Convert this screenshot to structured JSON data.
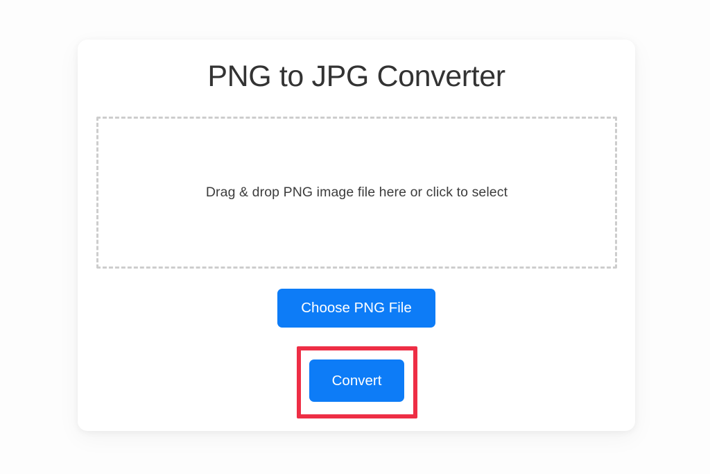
{
  "page": {
    "background_color": "#fdfdfd"
  },
  "card": {
    "title": "PNG to JPG Converter",
    "background_color": "#ffffff"
  },
  "dropzone": {
    "label": "Drag & drop PNG image file here or click to select",
    "border_style": "dashed",
    "border_color": "#cdcdcd"
  },
  "actions": {
    "choose_file_label": "Choose PNG File",
    "convert_label": "Convert",
    "button_color": "#0d7cf7",
    "button_text_color": "#ffffff"
  },
  "annotation": {
    "highlight_color": "#ee2e45",
    "target": "Convert"
  }
}
